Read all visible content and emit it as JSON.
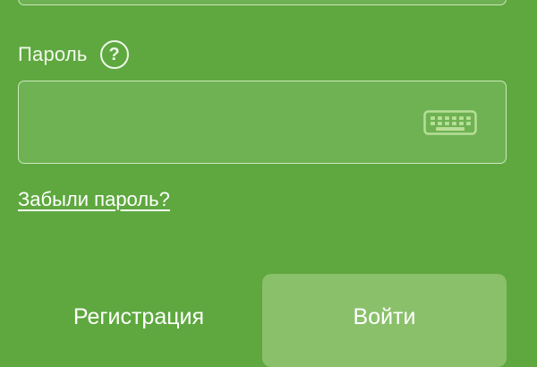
{
  "colors": {
    "background": "#5ea83f",
    "field_fill": "#6fb253",
    "login_button_fill": "#8bc06b",
    "keyboard_icon": "#b7df97",
    "text": "#ffffff"
  },
  "password": {
    "label": "Пароль",
    "help_icon": "question-circle-icon",
    "value": "",
    "keyboard_icon": "keyboard-icon"
  },
  "forgot_link": "Забыли пароль?",
  "actions": {
    "register_label": "Регистрация",
    "login_label": "Войти"
  }
}
